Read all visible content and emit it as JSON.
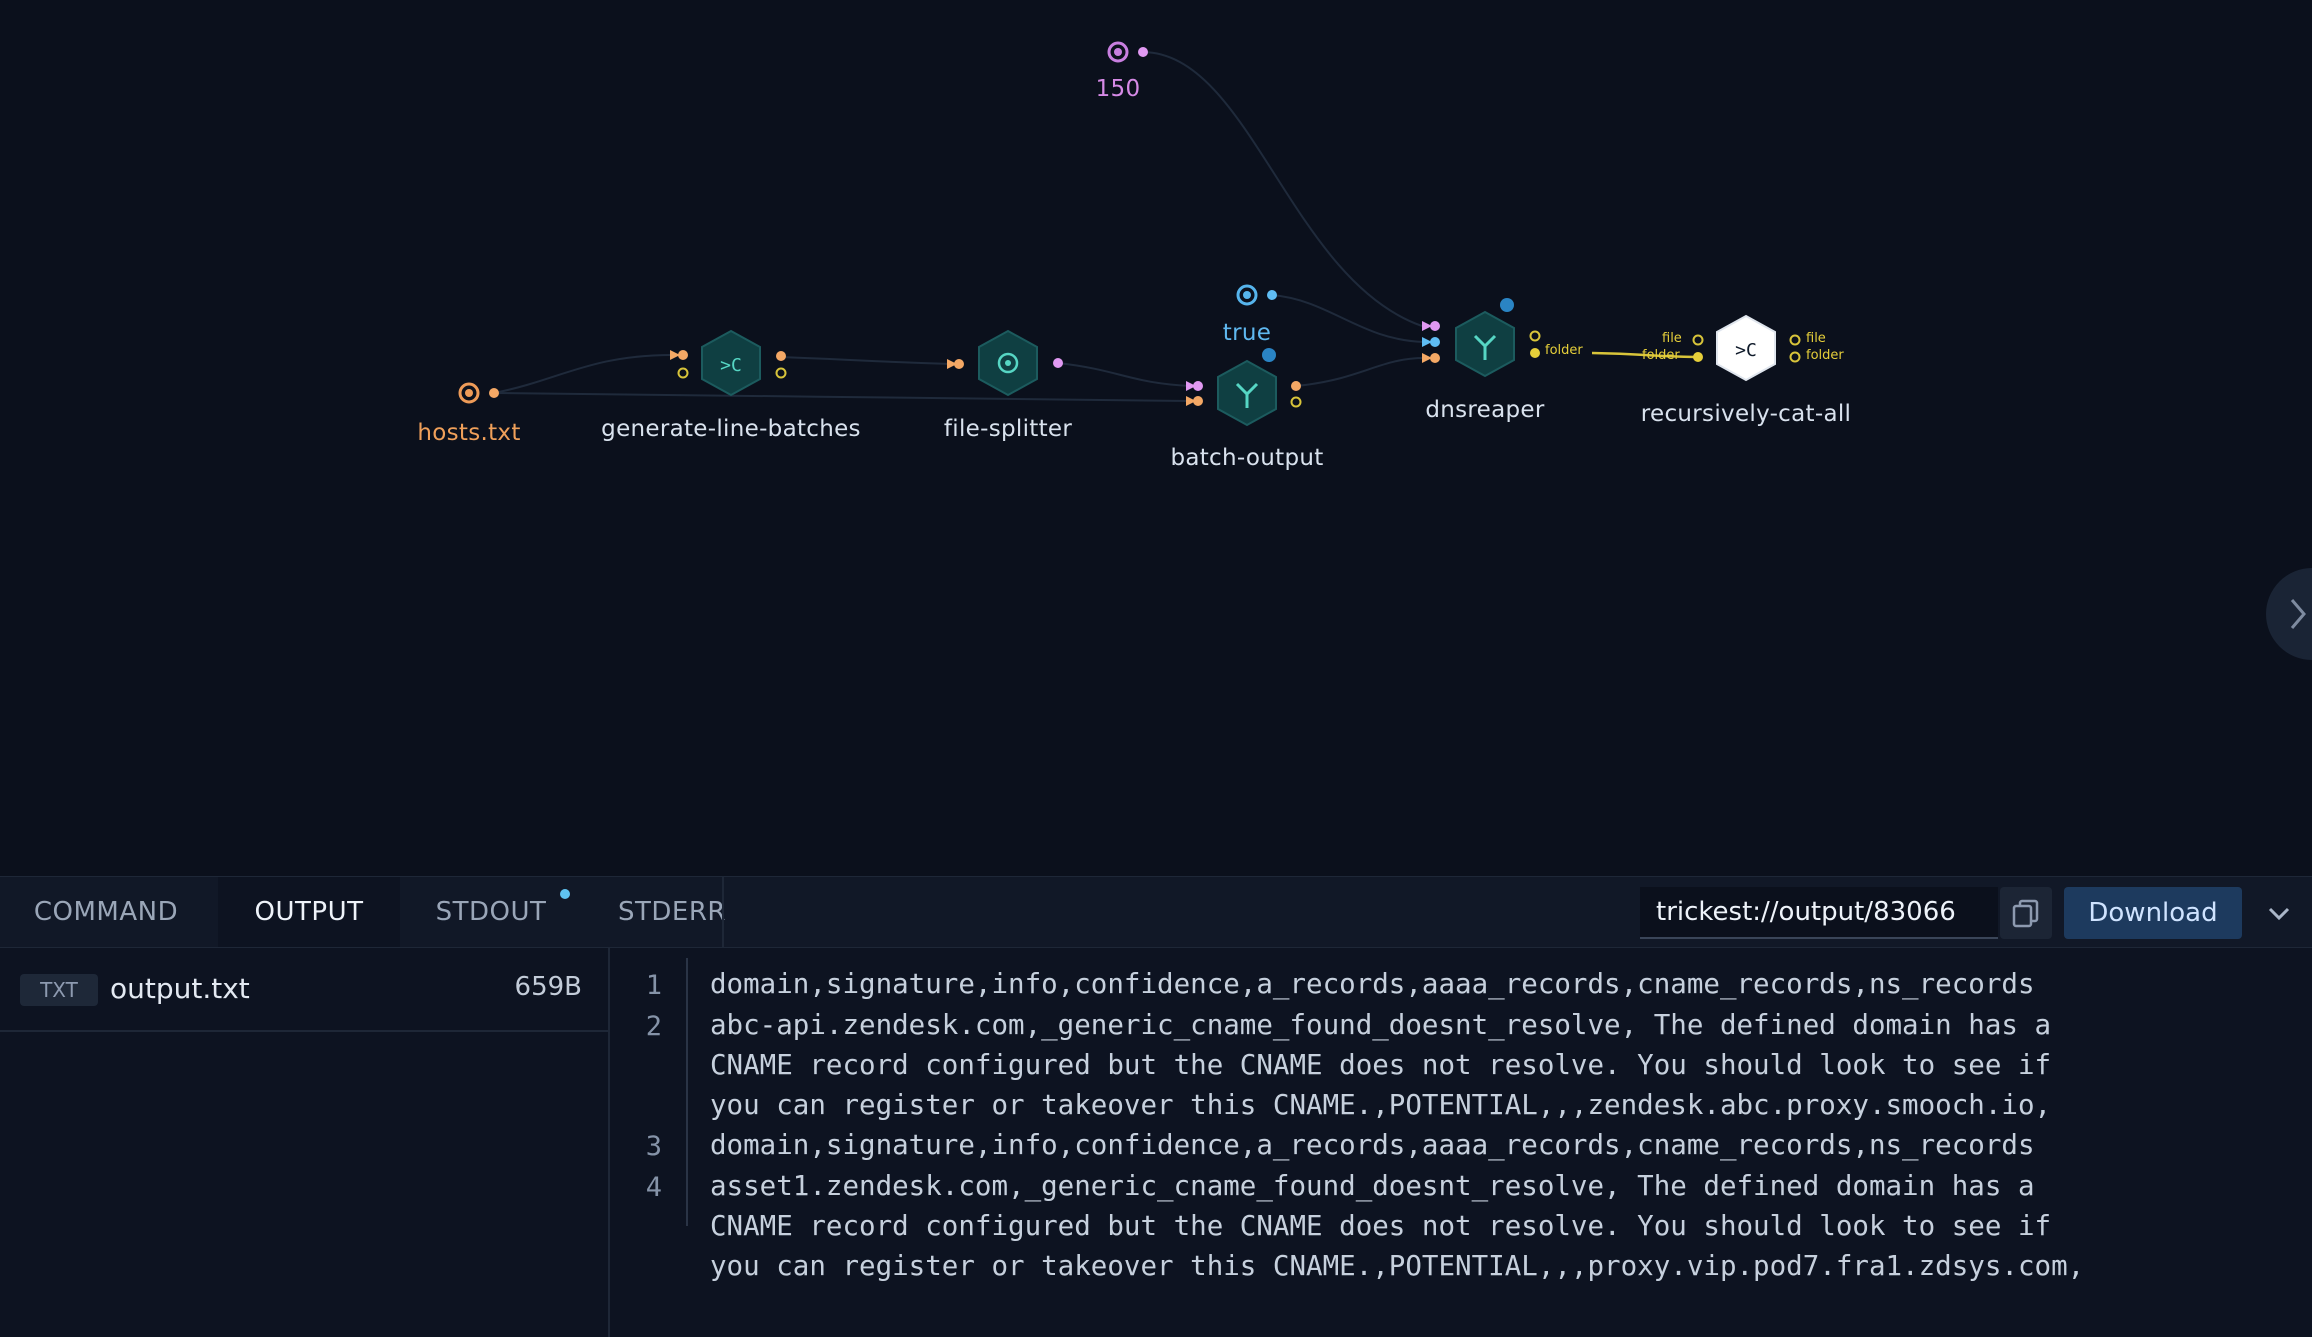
{
  "workflow": {
    "inputs": {
      "threads_value": "150",
      "flag_value": "true",
      "file_name": "hosts.txt"
    },
    "nodes": {
      "generate_line_batches": "generate-line-batches",
      "file_splitter": "file-splitter",
      "batch_output": "batch-output",
      "dnsreaper": "dnsreaper",
      "recursively_cat_all": "recursively-cat-all"
    },
    "ports": {
      "dnsreaper_out_folder": "folder",
      "cat_in_file": "file",
      "cat_in_folder": "folder",
      "cat_out_file": "file",
      "cat_out_folder": "folder"
    },
    "colors": {
      "teal_node": "#0f4a4a",
      "orange": "#f0a05a",
      "pink": "#d68ae6",
      "blue": "#5fb8f0",
      "yellow": "#e6cf3a"
    }
  },
  "panel": {
    "tabs": [
      {
        "label": "COMMAND",
        "active": false
      },
      {
        "label": "OUTPUT",
        "active": true
      },
      {
        "label": "STDOUT",
        "active": false,
        "badge": true
      },
      {
        "label": "STDERR",
        "active": false
      }
    ],
    "output_url": "trickest://output/83066",
    "download_label": "Download",
    "files": [
      {
        "type": "TXT",
        "name": "output.txt",
        "size": "659B"
      }
    ],
    "lines": [
      {
        "n": "1",
        "text": "domain,signature,info,confidence,a_records,aaaa_records,cname_records,ns_records"
      },
      {
        "n": "2",
        "text": "abc-api.zendesk.com,_generic_cname_found_doesnt_resolve, The defined domain has a\nCNAME record configured but the CNAME does not resolve. You should look to see if\nyou can register or takeover this CNAME.,POTENTIAL,,,zendesk.abc.proxy.smooch.io,"
      },
      {
        "n": "3",
        "text": "domain,signature,info,confidence,a_records,aaaa_records,cname_records,ns_records"
      },
      {
        "n": "4",
        "text": "asset1.zendesk.com,_generic_cname_found_doesnt_resolve, The defined domain has a\nCNAME record configured but the CNAME does not resolve. You should look to see if\nyou can register or takeover this CNAME.,POTENTIAL,,,proxy.vip.pod7.fra1.zdsys.com,"
      }
    ]
  }
}
